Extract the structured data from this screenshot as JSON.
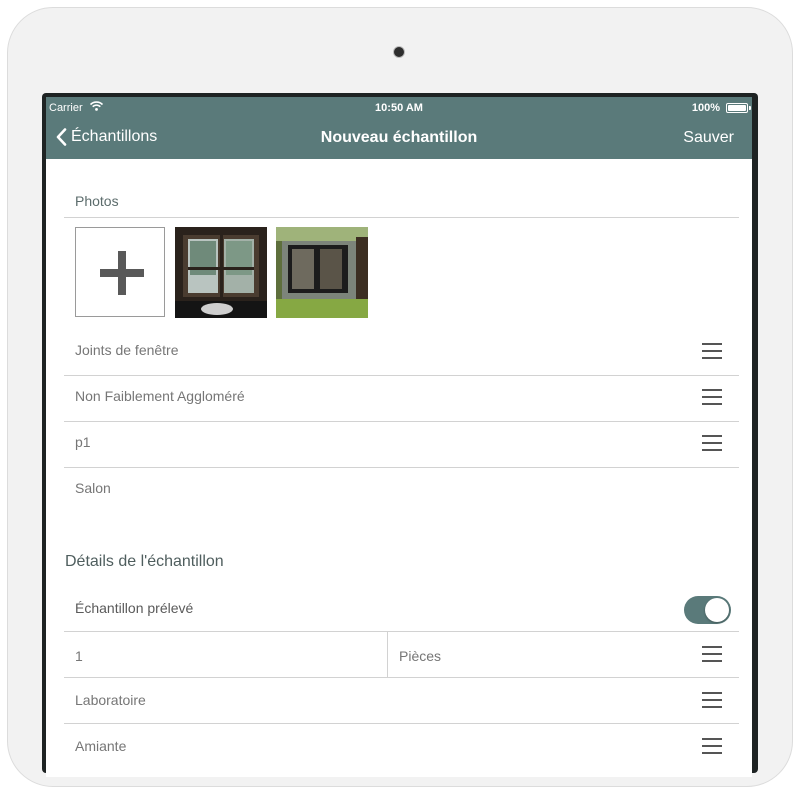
{
  "status_bar": {
    "carrier": "Carrier",
    "time": "10:50 AM",
    "battery": "100%"
  },
  "nav": {
    "back_label": "Échantillons",
    "title": "Nouveau échantillon",
    "save_label": "Sauver"
  },
  "photos": {
    "label": "Photos"
  },
  "rows": [
    "Joints de fenêtre",
    "Non Faiblement Aggloméré",
    "p1",
    "Salon"
  ],
  "details": {
    "title": "Détails de l'échantillon",
    "sampled_label": "Échantillon prélevé",
    "sampled_on": true,
    "quantity": "1",
    "unit": "Pièces",
    "laboratory": "Laboratoire",
    "analysis": "Amiante"
  },
  "colors": {
    "header": "#5a7a7a",
    "toggle_on": "#5a7a7a"
  },
  "icons": [
    "wifi-icon",
    "battery-icon",
    "chevron-left-icon",
    "plus-icon",
    "menu-icon"
  ]
}
